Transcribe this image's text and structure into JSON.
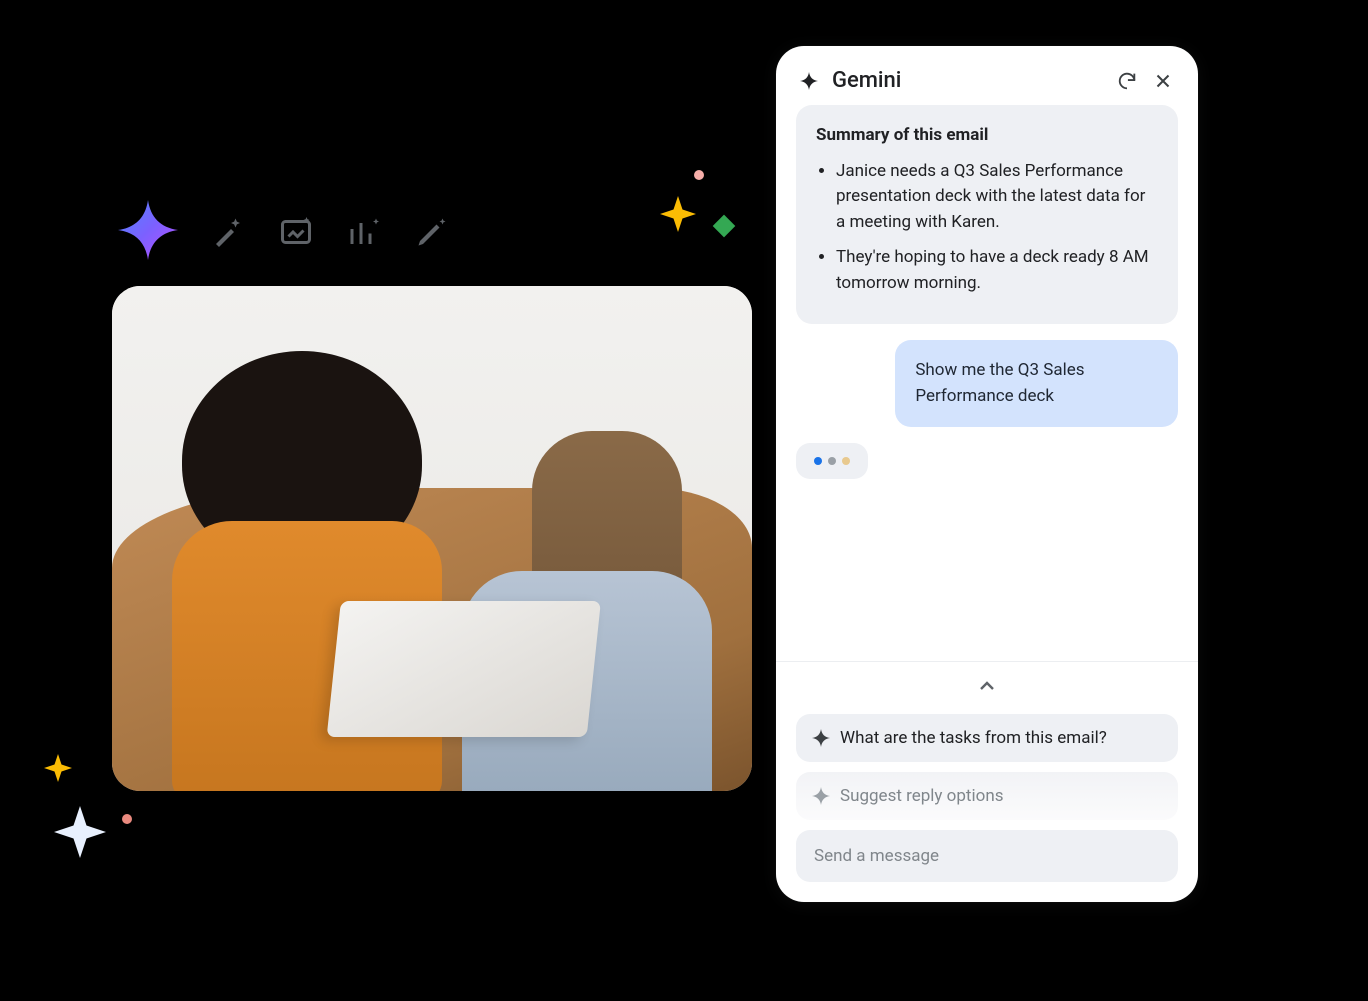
{
  "panel": {
    "title": "Gemini",
    "summary_heading": "Summary of this email",
    "summary_items": [
      "Janice needs a Q3 Sales Performance presentation deck with the latest data for a meeting with Karen.",
      "They're hoping to have a deck ready 8 AM tomorrow morning."
    ],
    "user_message": "Show me the Q3 Sales Performance deck",
    "suggestions": [
      "What are the tasks from this email?",
      "Suggest reply options"
    ],
    "input_placeholder": "Send a message"
  },
  "toolbar_icons": [
    "gemini-spark-icon",
    "magic-wand-icon",
    "image-spark-icon",
    "chart-spark-icon",
    "pencil-spark-icon"
  ]
}
